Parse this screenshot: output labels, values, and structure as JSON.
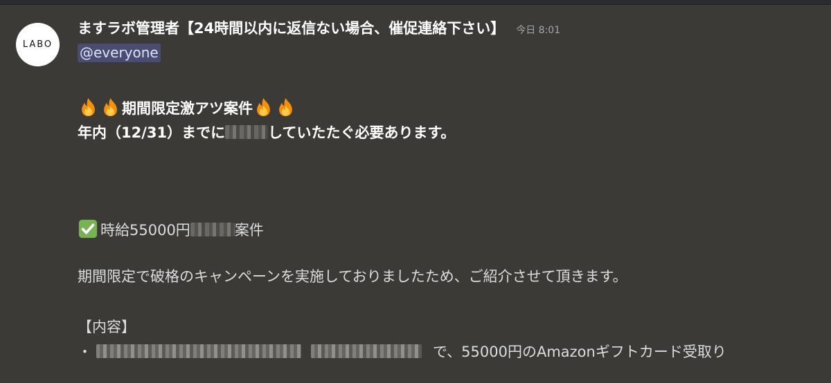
{
  "avatar": {
    "text": "LABO"
  },
  "message": {
    "username": "ますラボ管理者【24時間以内に返信ない場合、催促連絡下さい】",
    "timestamp": "今日 8:01",
    "mention": "@everyone",
    "headline": "期間限定激アツ案件",
    "deadline_prefix": "年内（12/31）までに",
    "deadline_suffix": "していたたぐ必要あります。",
    "rate_prefix": "時給55000円",
    "rate_suffix": "案件",
    "campaign_text": "期間限定で破格のキャンペーンを実施しておりましたため、ご紹介させて頂きます。",
    "section_title": "【内容】",
    "bullet": "・",
    "reward_text": "で、55000円のAmazonギフトカード受取り"
  },
  "emoji": {
    "fire": "fire-emoji",
    "check": "check-mark-button-emoji"
  },
  "colors": {
    "background": "#3b3a37",
    "mention_bg": "#4a4d72",
    "mention_text": "#dee0fc",
    "username": "#ffffff",
    "timestamp": "#a3a6aa"
  }
}
